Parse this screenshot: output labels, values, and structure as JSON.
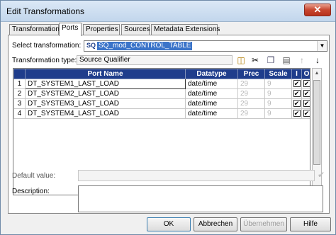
{
  "window": {
    "title": "Edit Transformations"
  },
  "tabs": [
    {
      "label": "Transformation"
    },
    {
      "label": "Ports"
    },
    {
      "label": "Properties"
    },
    {
      "label": "Sources"
    },
    {
      "label": "Metadata Extensions"
    }
  ],
  "active_tab": "Ports",
  "select_transformation": {
    "label": "Select transformation:",
    "prefix": "SQ",
    "value": "SQ_mod_CONTROL_TABLE"
  },
  "transformation_type": {
    "label": "Transformation type:",
    "value": "Source Qualifier"
  },
  "toolbar": {
    "icons": [
      "new-port-icon",
      "cut-icon",
      "copy-icon",
      "paste-icon",
      "move-up-icon",
      "move-down-icon"
    ]
  },
  "ports_table": {
    "headers": {
      "name": "Port Name",
      "datatype": "Datatype",
      "prec": "Prec",
      "scale": "Scale",
      "input": "I",
      "output": "O"
    },
    "rows": [
      {
        "num": "1",
        "name": "DT_SYSTEM1_LAST_LOAD",
        "datatype": "date/time",
        "prec": "29",
        "scale": "9",
        "input": "✔",
        "output": "✔"
      },
      {
        "num": "2",
        "name": "DT_SYSTEM2_LAST_LOAD",
        "datatype": "date/time",
        "prec": "29",
        "scale": "9",
        "input": "✔",
        "output": "✔"
      },
      {
        "num": "3",
        "name": "DT_SYSTEM3_LAST_LOAD",
        "datatype": "date/time",
        "prec": "29",
        "scale": "9",
        "input": "✔",
        "output": "✔"
      },
      {
        "num": "4",
        "name": "DT_SYSTEM4_LAST_LOAD",
        "datatype": "date/time",
        "prec": "29",
        "scale": "9",
        "input": "✔",
        "output": "✔"
      }
    ]
  },
  "default_value": {
    "label": "Default value:",
    "value": ""
  },
  "description": {
    "label": "Description:",
    "value": ""
  },
  "buttons": {
    "ok": "OK",
    "cancel": "Abbrechen",
    "apply": "Übernehmen",
    "help": "Hilfe"
  },
  "colors": {
    "header_bg": "#1f3d8c",
    "selection": "#3b74c9"
  }
}
